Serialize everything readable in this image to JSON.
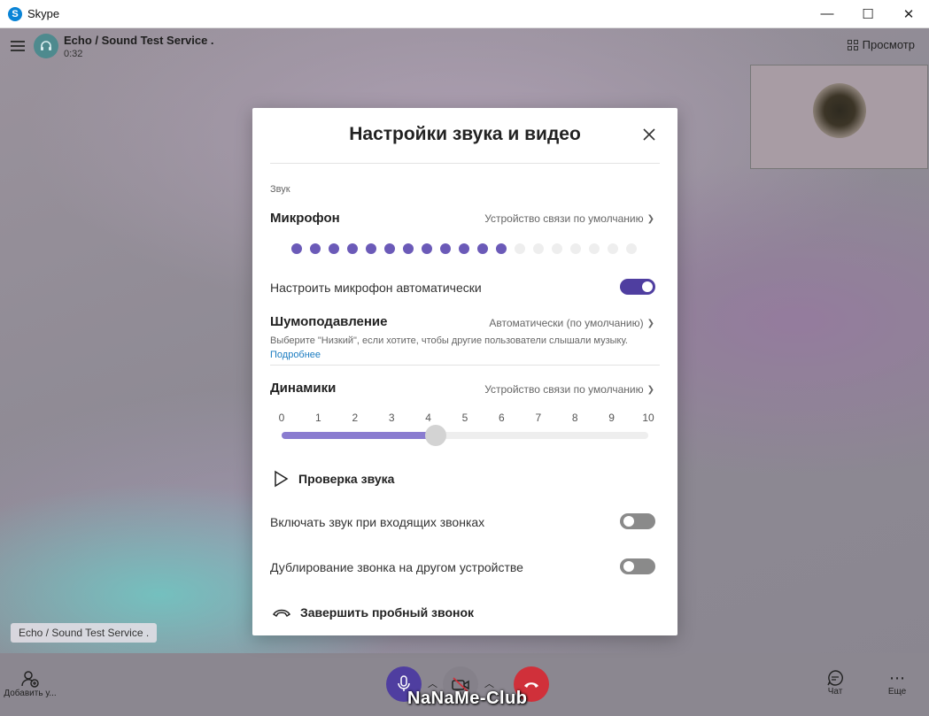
{
  "window": {
    "title": "Skype",
    "minimize": "—",
    "maximize": "☐",
    "close": "✕"
  },
  "call": {
    "contact_name": "Echo / Sound Test Service .",
    "duration": "0:32",
    "preview_label": "Просмотр",
    "name_tag": "Echo / Sound Test Service ."
  },
  "dialog": {
    "title": "Настройки звука и видео",
    "section_sound": "Звук",
    "microphone": {
      "label": "Микрофон",
      "device": "Устройство связи по умолчанию",
      "level_dots_total": 19,
      "level_dots_active": 12
    },
    "auto_adjust": {
      "label": "Настроить микрофон автоматически",
      "on": true
    },
    "noise": {
      "label": "Шумоподавление",
      "value": "Автоматически (по умолчанию)",
      "hint": "Выберите \"Низкий\", если хотите, чтобы другие пользователи слышали музыку.",
      "link": "Подробнее"
    },
    "speakers": {
      "label": "Динамики",
      "device": "Устройство связи по умолчанию",
      "scale": [
        "0",
        "1",
        "2",
        "3",
        "4",
        "5",
        "6",
        "7",
        "8",
        "9",
        "10"
      ],
      "volume": 4.2
    },
    "test_sound": "Проверка звука",
    "auto_answer": {
      "label": "Включать звук при входящих звонках",
      "on": false
    },
    "ring_duplicate": {
      "label": "Дублирование звонка на другом устройстве",
      "on": false
    },
    "end_test": "Завершить пробный звонок"
  },
  "bottombar": {
    "add_label": "Добавить у...",
    "chat_label": "Чат",
    "more_label": "Еще"
  },
  "watermark": "NaNaMe-Club",
  "colors": {
    "accent": "#4f3ea0",
    "mic_dot_active": "#6b5ab8",
    "hangup": "#d0303a",
    "link": "#1a7bc0"
  }
}
